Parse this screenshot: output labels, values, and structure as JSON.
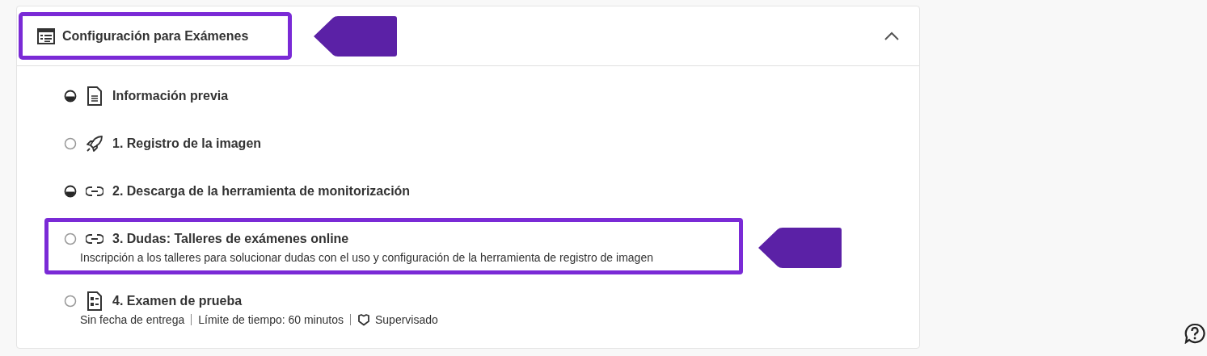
{
  "section": {
    "title": "Configuración para Exámenes",
    "highlighted": true,
    "expanded": true
  },
  "items": [
    {
      "kind": "document",
      "started": true,
      "title": "Información previa",
      "highlighted": false
    },
    {
      "kind": "rocket",
      "started": false,
      "title": "1. Registro de la imagen",
      "highlighted": false
    },
    {
      "kind": "link",
      "started": true,
      "title": "2. Descarga de la herramienta de monitorización",
      "highlighted": false
    },
    {
      "kind": "link",
      "started": false,
      "title": "3. Dudas: Talleres de exámenes online",
      "description": "Inscripción a los talleres para solucionar dudas con el uso y configuración de la herramienta de registro de imagen",
      "highlighted": true
    },
    {
      "kind": "test",
      "started": false,
      "title": "4. Examen de prueba",
      "highlighted": false,
      "meta": [
        {
          "kind": "plain",
          "text": "Sin fecha de entrega"
        },
        {
          "kind": "plain",
          "text": "Límite de tiempo: 60 minutos"
        },
        {
          "kind": "proctored",
          "text": "Supervisado"
        }
      ]
    }
  ]
}
